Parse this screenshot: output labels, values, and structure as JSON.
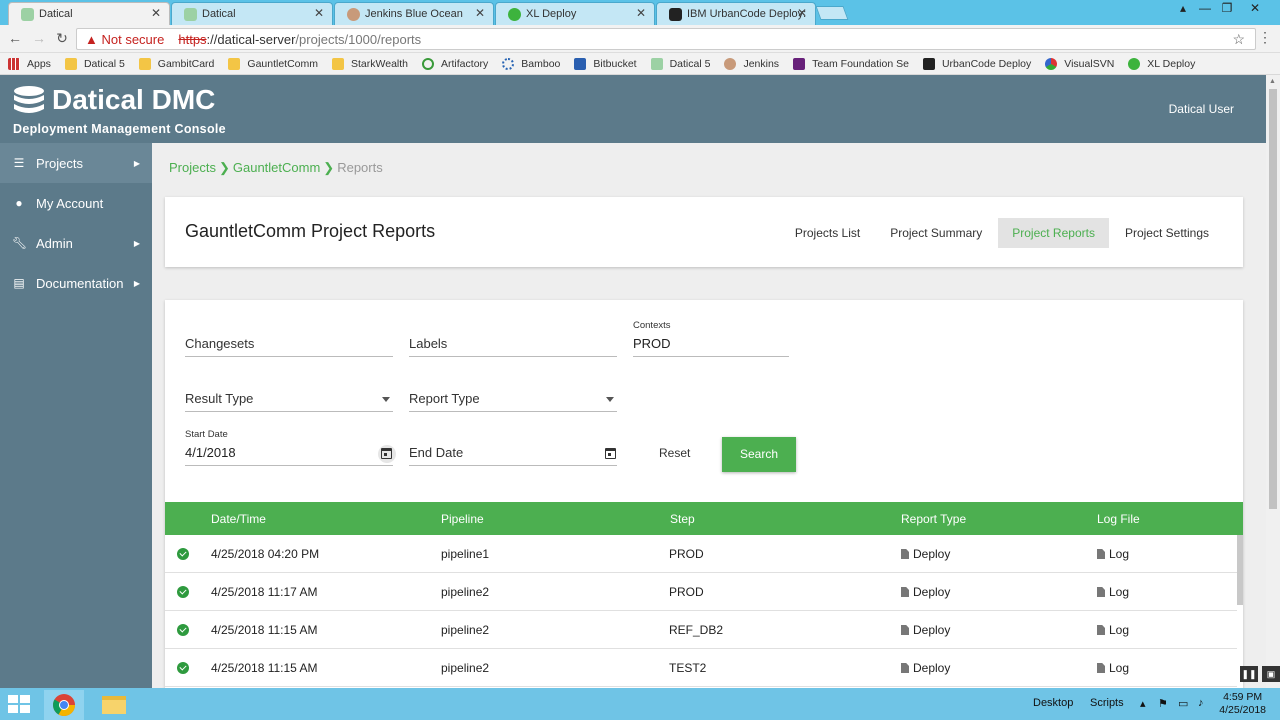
{
  "browser": {
    "tabs": [
      {
        "title": "Datical",
        "active": true
      },
      {
        "title": "Datical",
        "active": false
      },
      {
        "title": "Jenkins Blue Ocean",
        "active": false
      },
      {
        "title": "XL Deploy",
        "active": false
      },
      {
        "title": "IBM UrbanCode Deploy:",
        "active": false
      }
    ],
    "not_secure": "Not secure",
    "url_scheme": "https",
    "url_host": "://datical-server",
    "url_path": "/projects/1000/reports",
    "bookmarks": [
      "Apps",
      "Datical 5",
      "GambitCard",
      "GauntletComm",
      "StarkWealth",
      "Artifactory",
      "Bamboo",
      "Bitbucket",
      "Datical 5",
      "Jenkins",
      "Team Foundation Se",
      "UrbanCode Deploy",
      "VisualSVN",
      "XL Deploy"
    ]
  },
  "app": {
    "logo_text": "Datical DMC",
    "subtitle": "Deployment Management Console",
    "user": "Datical User"
  },
  "sidebar": {
    "items": [
      {
        "label": "Projects",
        "icon": "list-icon",
        "arrow": true
      },
      {
        "label": "My Account",
        "icon": "user-icon",
        "arrow": false
      },
      {
        "label": "Admin",
        "icon": "wrench-icon",
        "arrow": true
      },
      {
        "label": "Documentation",
        "icon": "book-icon",
        "arrow": true
      }
    ]
  },
  "breadcrumb": {
    "projects": "Projects",
    "project": "GauntletComm",
    "current": "Reports"
  },
  "page": {
    "title": "GauntletComm Project Reports",
    "tabs": [
      "Projects List",
      "Project Summary",
      "Project Reports",
      "Project Settings"
    ],
    "active_tab": "Project Reports"
  },
  "filters": {
    "changesets_placeholder": "Changesets",
    "labels_placeholder": "Labels",
    "contexts_label": "Contexts",
    "contexts_value": "PROD",
    "result_type_placeholder": "Result Type",
    "report_type_placeholder": "Report Type",
    "start_date_label": "Start Date",
    "start_date_value": "4/1/2018",
    "end_date_placeholder": "End Date",
    "reset_label": "Reset",
    "search_label": "Search"
  },
  "table": {
    "columns": [
      "Date/Time",
      "Pipeline",
      "Step",
      "Report Type",
      "Log File"
    ],
    "rows": [
      {
        "datetime": "4/25/2018 04:20 PM",
        "pipeline": "pipeline1",
        "step": "PROD",
        "report": "Deploy",
        "log": "Log"
      },
      {
        "datetime": "4/25/2018 11:17 AM",
        "pipeline": "pipeline2",
        "step": "PROD",
        "report": "Deploy",
        "log": "Log"
      },
      {
        "datetime": "4/25/2018 11:15 AM",
        "pipeline": "pipeline2",
        "step": "REF_DB2",
        "report": "Deploy",
        "log": "Log"
      },
      {
        "datetime": "4/25/2018 11:15 AM",
        "pipeline": "pipeline2",
        "step": "TEST2",
        "report": "Deploy",
        "log": "Log"
      }
    ]
  },
  "taskbar": {
    "desktop_label": "Desktop",
    "scripts_label": "Scripts",
    "time": "4:59 PM",
    "date": "4/25/2018"
  },
  "colors": {
    "accent": "#4caf50",
    "header": "#5c7a8a",
    "tabstrip": "#5bc2e7"
  }
}
